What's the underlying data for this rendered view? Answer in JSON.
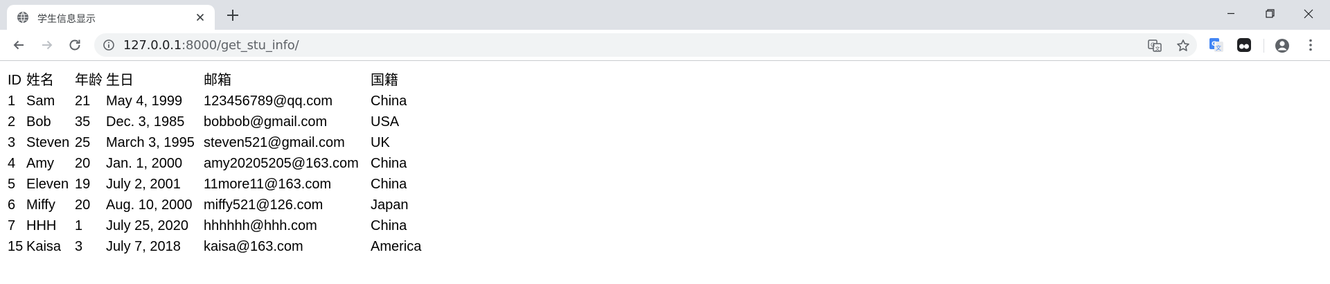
{
  "browser": {
    "tab": {
      "title": "学生信息显示",
      "favicon": "globe-icon"
    },
    "address": {
      "host": "127.0.0.1",
      "rest": ":8000/get_stu_info/"
    },
    "icons": [
      "back-arrow-icon",
      "forward-arrow-icon",
      "reload-icon",
      "info-icon",
      "translate-icon",
      "star-icon",
      "google-translate-extension-icon",
      "tampermonkey-extension-icon",
      "profile-icon",
      "menu-icon",
      "minimize-icon",
      "maximize-icon",
      "close-icon"
    ]
  },
  "table": {
    "headers": [
      "ID",
      "姓名",
      "年龄",
      "生日",
      "邮箱",
      "国籍"
    ],
    "rows": [
      [
        "1",
        "Sam",
        "21",
        "May 4, 1999",
        "123456789@qq.com",
        "China"
      ],
      [
        "2",
        "Bob",
        "35",
        "Dec. 3, 1985",
        "bobbob@gmail.com",
        "USA"
      ],
      [
        "3",
        "Steven",
        "25",
        "March 3, 1995",
        "steven521@gmail.com",
        "UK"
      ],
      [
        "4",
        "Amy",
        "20",
        "Jan. 1, 2000",
        "amy20205205@163.com",
        "China"
      ],
      [
        "5",
        "Eleven",
        "19",
        "July 2, 2001",
        "11more11@163.com",
        "China"
      ],
      [
        "6",
        "Miffy",
        "20",
        "Aug. 10, 2000",
        "miffy521@126.com",
        "Japan"
      ],
      [
        "7",
        "HHH",
        "1",
        "July 25, 2020",
        "hhhhhh@hhh.com",
        "China"
      ],
      [
        "15",
        "Kaisa",
        "3",
        "July 7, 2018",
        "kaisa@163.com",
        "America"
      ]
    ]
  },
  "colors": {
    "tabstrip": "#dee1e6",
    "omnibox": "#f1f3f4",
    "icon": "#5f6368",
    "translate_ext": "#4285f4"
  }
}
